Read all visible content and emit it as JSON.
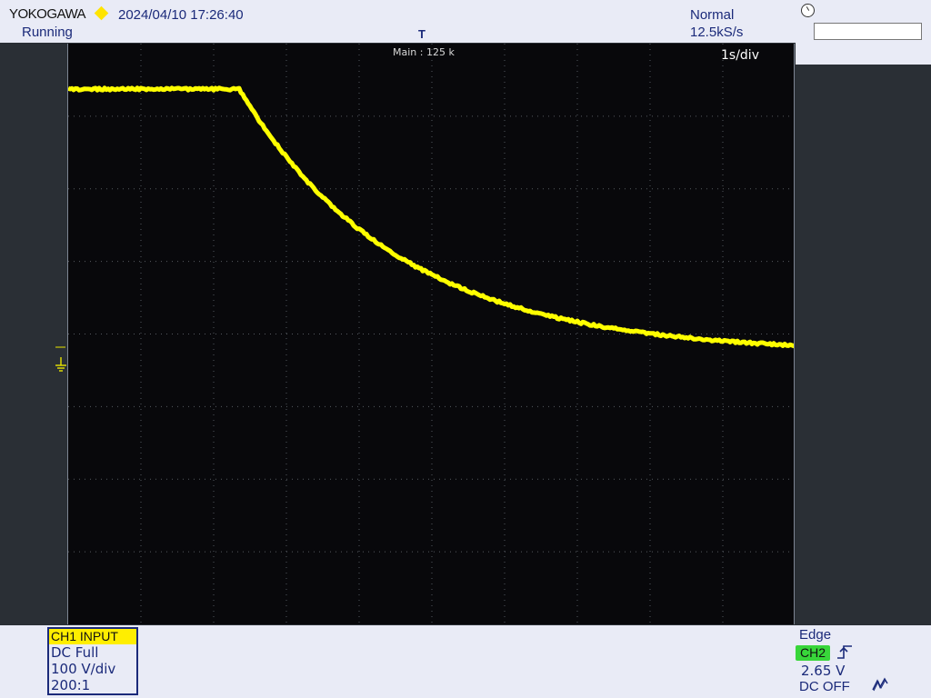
{
  "header": {
    "brand": "YOKOGAWA",
    "datetime": "2024/04/10 17:26:40",
    "status": "Running",
    "acq_mode": "Normal",
    "sample_rate": "12.5kS/s",
    "trigger_marker": "T"
  },
  "screen": {
    "main_record": "Main : 125 k",
    "time_base": "1s/div",
    "waveform_color": "#ffff00"
  },
  "channel": {
    "header": "CH1  INPUT",
    "coupling": "DC Full",
    "scale": "100 V/div",
    "probe": "200:1",
    "color": "#ffee00"
  },
  "trigger": {
    "type": "Edge",
    "source": "CH2",
    "source_color": "#38d63a",
    "level": "2.65 V",
    "coupling": "DC OFF",
    "slope_icon": "rising-edge-icon",
    "noise_icon": "hysteresis-icon"
  }
}
